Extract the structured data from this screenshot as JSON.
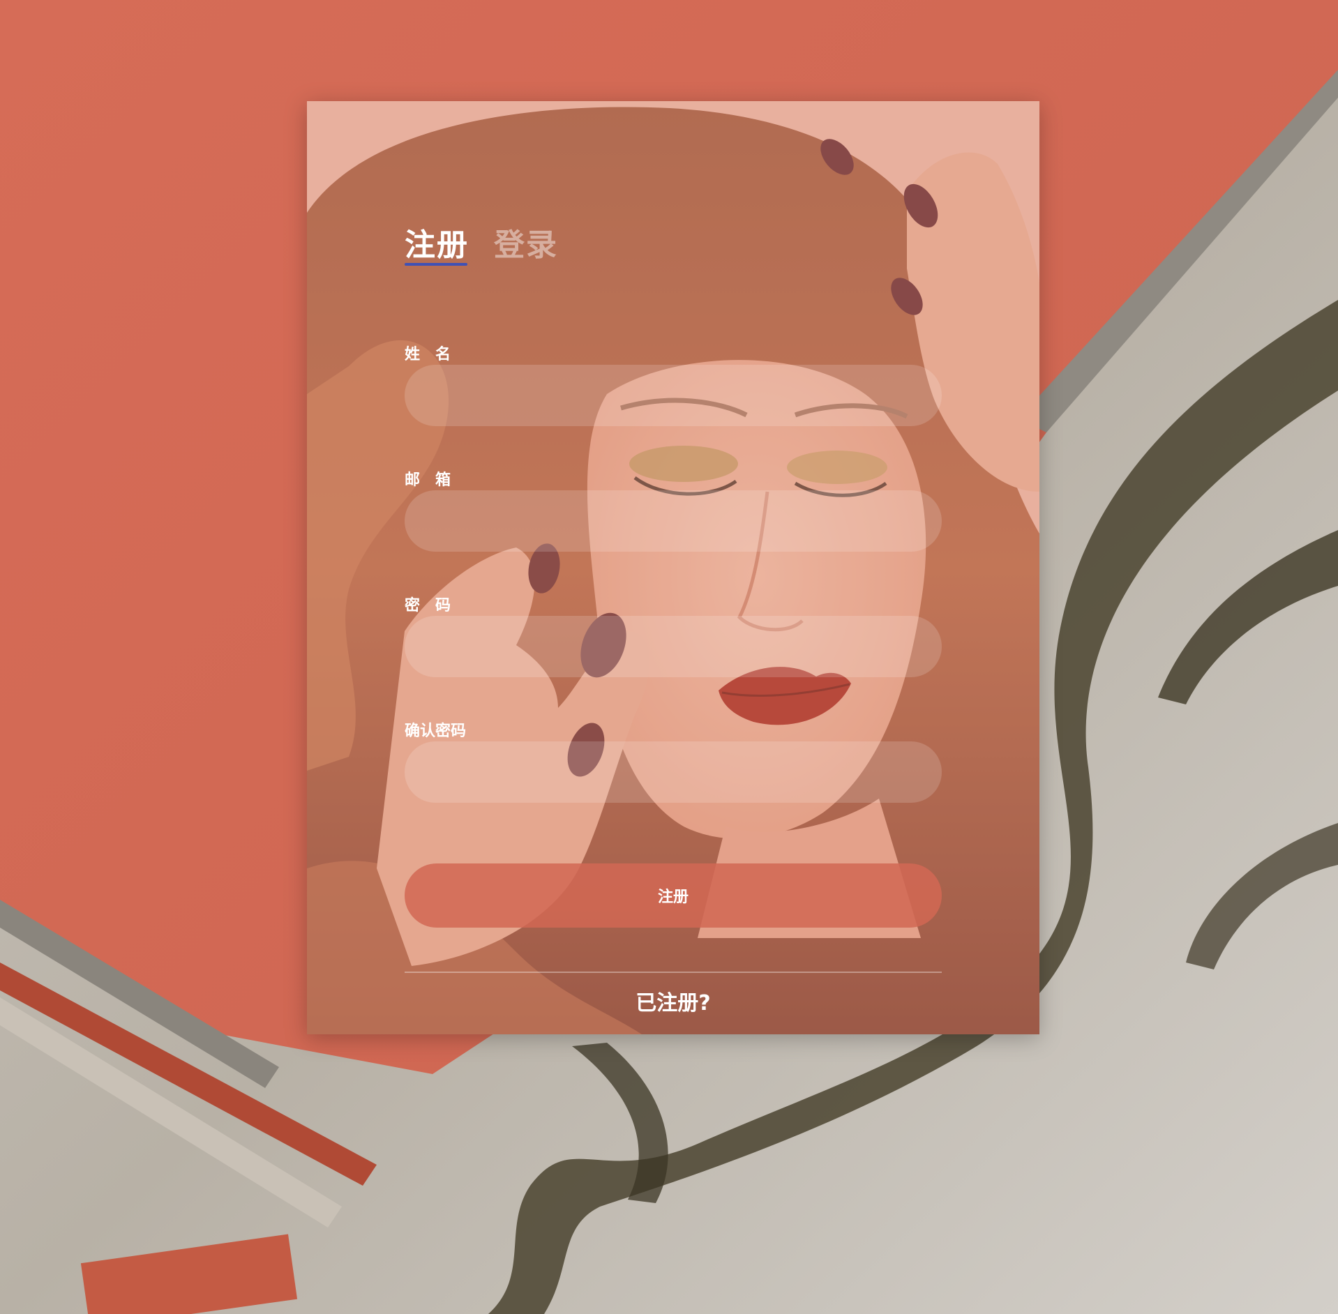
{
  "colors": {
    "page_background": "#d26a55",
    "tab_underline": "#3f51b5",
    "button": "#d26854",
    "text": "#ffffff"
  },
  "tabs": {
    "register": "注册",
    "login": "登录"
  },
  "form": {
    "name_label": "姓　名",
    "email_label": "邮　箱",
    "password_label": "密　码",
    "confirm_label": "确认密码",
    "name_value": "",
    "email_value": "",
    "password_value": "",
    "confirm_value": "",
    "submit_label": "注册"
  },
  "footer": {
    "link": "已注册?"
  }
}
